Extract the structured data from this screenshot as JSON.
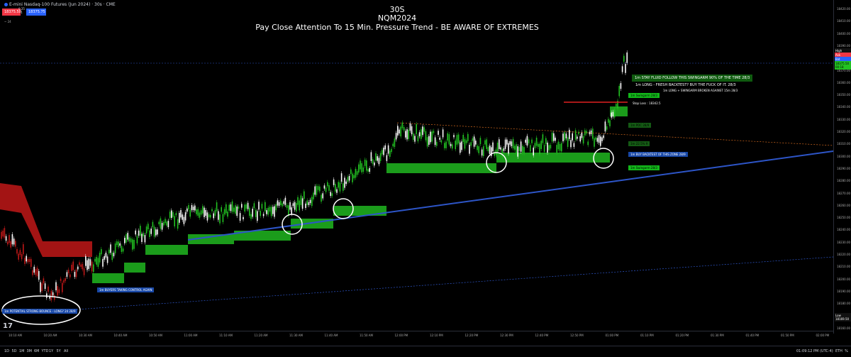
{
  "header": {
    "symbol": "E-mini Nasdaq-100 Futures (Jun 2024) · 30s · CME",
    "sell_price": "18375.50",
    "buy_price": "18375.75",
    "spread": "0.25",
    "spread_unit": "1",
    "volume": "~ 24"
  },
  "titles": {
    "line1": "30S",
    "line2": "NQM2024",
    "line3": "Pay Close Attention To 15 Min. Pressure Trend   - BE AWARE OF EXTREMES"
  },
  "price_axis": {
    "ticks": [
      "18420.00",
      "18410.00",
      "18400.00",
      "18390.00",
      "18380.00",
      "18370.00",
      "18360.00",
      "18350.00",
      "18340.00",
      "18330.00",
      "18320.00",
      "18310.00",
      "18300.00",
      "18290.00",
      "18280.00",
      "18270.00",
      "18260.00",
      "18250.00",
      "18240.00",
      "18230.00",
      "18220.00",
      "18210.00",
      "18200.00",
      "18190.00",
      "18180.00",
      "18170.00",
      "18160.00"
    ],
    "labels": {
      "high_tag": "High",
      "high": "18382.50",
      "ask_tag": "Ask",
      "ask": "18375.75",
      "bid_tag": "Bid",
      "bid": "18375.50",
      "last": "18375.50",
      "countdown": "00:18",
      "low_tag": "Low",
      "low": "18169.50"
    }
  },
  "time_axis": {
    "ticks": [
      "10:10 AM",
      "10:20 AM",
      "10:30 AM",
      "10:40 AM",
      "10:50 AM",
      "11:00 AM",
      "11:10 AM",
      "11:20 AM",
      "11:30 AM",
      "11:40 AM",
      "11:50 AM",
      "12:00 PM",
      "12:10 PM",
      "12:20 PM",
      "12:30 PM",
      "12:40 PM",
      "12:50 PM",
      "01:00 PM",
      "01:10 PM",
      "01:20 PM",
      "01:30 PM",
      "01:40 PM",
      "01:50 PM",
      "02:00 PM"
    ]
  },
  "bottom_bar": {
    "ranges": [
      "1D",
      "5D",
      "1M",
      "3M",
      "6M",
      "YTD",
      "1Y",
      "5Y",
      "All"
    ],
    "clock": "01:09:12 PM (UTC-4)",
    "session": "ETH",
    "pct": "%"
  },
  "annotations": {
    "potential_bounce": "1m  POTENTIAL STRONG BOUNCE - LONG? 24 28/9",
    "buyers": "1m  BUYERS TAKING CONTROL AGAIN",
    "stay_fluid": "1m STAY FLUID FOLLOW THIS SWINGARM 90% OF THE TIME 28/3",
    "long_fresh": "1m  LONG - FRESH BACKTEST? BUY THE FUCK OF IT. 28/3",
    "long_swingarm": "1m LONG + SWINGARM BROKEN AGAINST 15m 28/3",
    "swingarm_top": "1m Swingarm 28/3",
    "stop_loss": "Stop Loss : 18342.5",
    "poc": "1m POC 28/9",
    "half": "1m 22.5% 9",
    "buy_backtest": "1m  BUY BACKTEST OF THIS ZONE 28/9",
    "swingarm_low": "1m Swingarm 28/3"
  },
  "colors": {
    "bullish": "#22c322",
    "bearish": "#c01818",
    "trendline": "#2d55c8",
    "stop": "#e02020",
    "resistance": "#d2691e",
    "background": "#000000"
  }
}
